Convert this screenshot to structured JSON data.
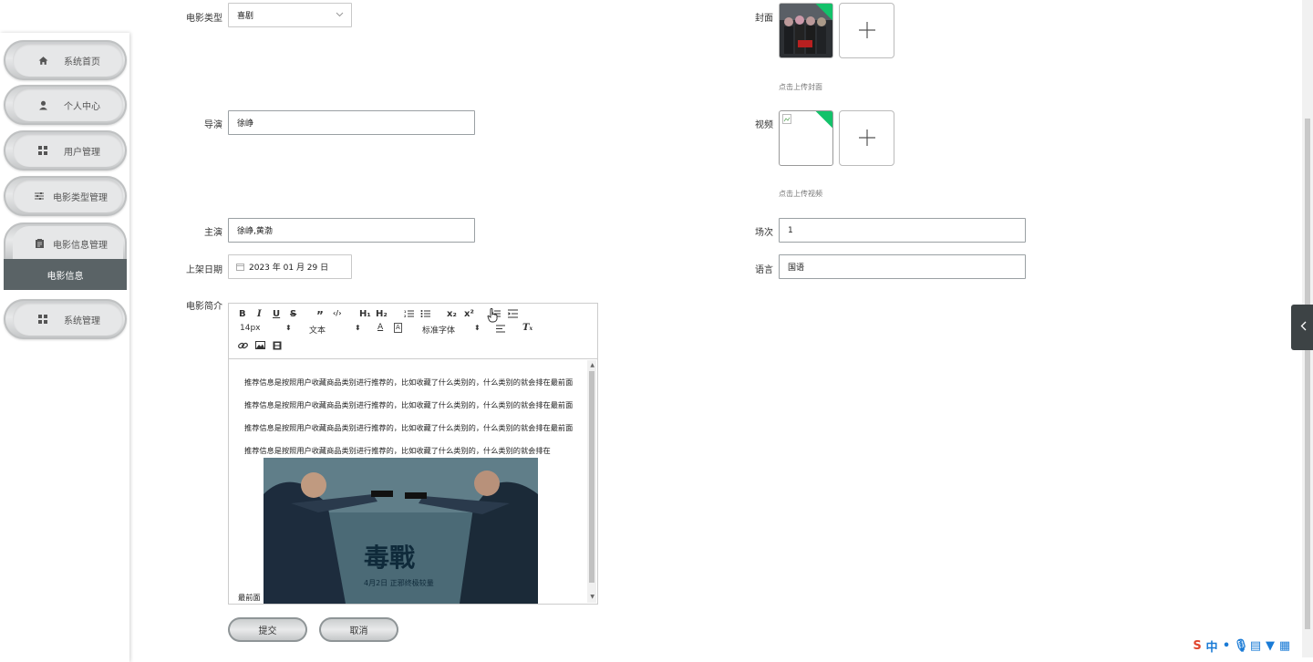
{
  "sidebar": {
    "items": [
      {
        "label": "系统首页",
        "icon": "home-icon"
      },
      {
        "label": "个人中心",
        "icon": "user-icon"
      },
      {
        "label": "用户管理",
        "icon": "grid-icon"
      },
      {
        "label": "电影类型管理",
        "icon": "sliders-icon"
      },
      {
        "label": "电影信息管理",
        "icon": "clipboard-icon"
      },
      {
        "label": "系统管理",
        "icon": "grid-icon"
      }
    ],
    "active_sub": "电影信息"
  },
  "form": {
    "movie_type": {
      "label": "电影类型",
      "value": "喜剧"
    },
    "cover": {
      "label": "封面",
      "hint": "点击上传封面"
    },
    "director": {
      "label": "导演",
      "value": "徐峥"
    },
    "video": {
      "label": "视频",
      "hint": "点击上传视频"
    },
    "cast": {
      "label": "主演",
      "value": "徐峥,黄渤"
    },
    "session": {
      "label": "场次",
      "value": "1"
    },
    "release_date": {
      "label": "上架日期",
      "value": "2023 年 01 月 29 日"
    },
    "language": {
      "label": "语言",
      "value": "国语"
    },
    "intro": {
      "label": "电影简介",
      "toolbar": {
        "bold": "B",
        "italic": "I",
        "underline": "U",
        "strike": "S",
        "quote": "”",
        "code": "‹/›",
        "h1": "H₁",
        "h2": "H₂",
        "sub": "x₂",
        "sup": "x²",
        "size": "14px",
        "text": "文本",
        "font": "标准字体"
      },
      "paragraphs": [
        "推荐信息是按照用户收藏商品类别进行推荐的，比如收藏了什么类别的，什么类别的就会排在最前面",
        "推荐信息是按照用户收藏商品类别进行推荐的，比如收藏了什么类别的，什么类别的就会排在最前面",
        "推荐信息是按照用户收藏商品类别进行推荐的，比如收藏了什么类别的，什么类别的就会排在最前面",
        "推荐信息是按照用户收藏商品类别进行推荐的，比如收藏了什么类别的，什么类别的就会排在"
      ],
      "tail": "最前面",
      "poster": {
        "title": "毒戰",
        "date_line": "4月2日 正邪终极较量"
      }
    }
  },
  "actions": {
    "submit": "提交",
    "cancel": "取消"
  }
}
